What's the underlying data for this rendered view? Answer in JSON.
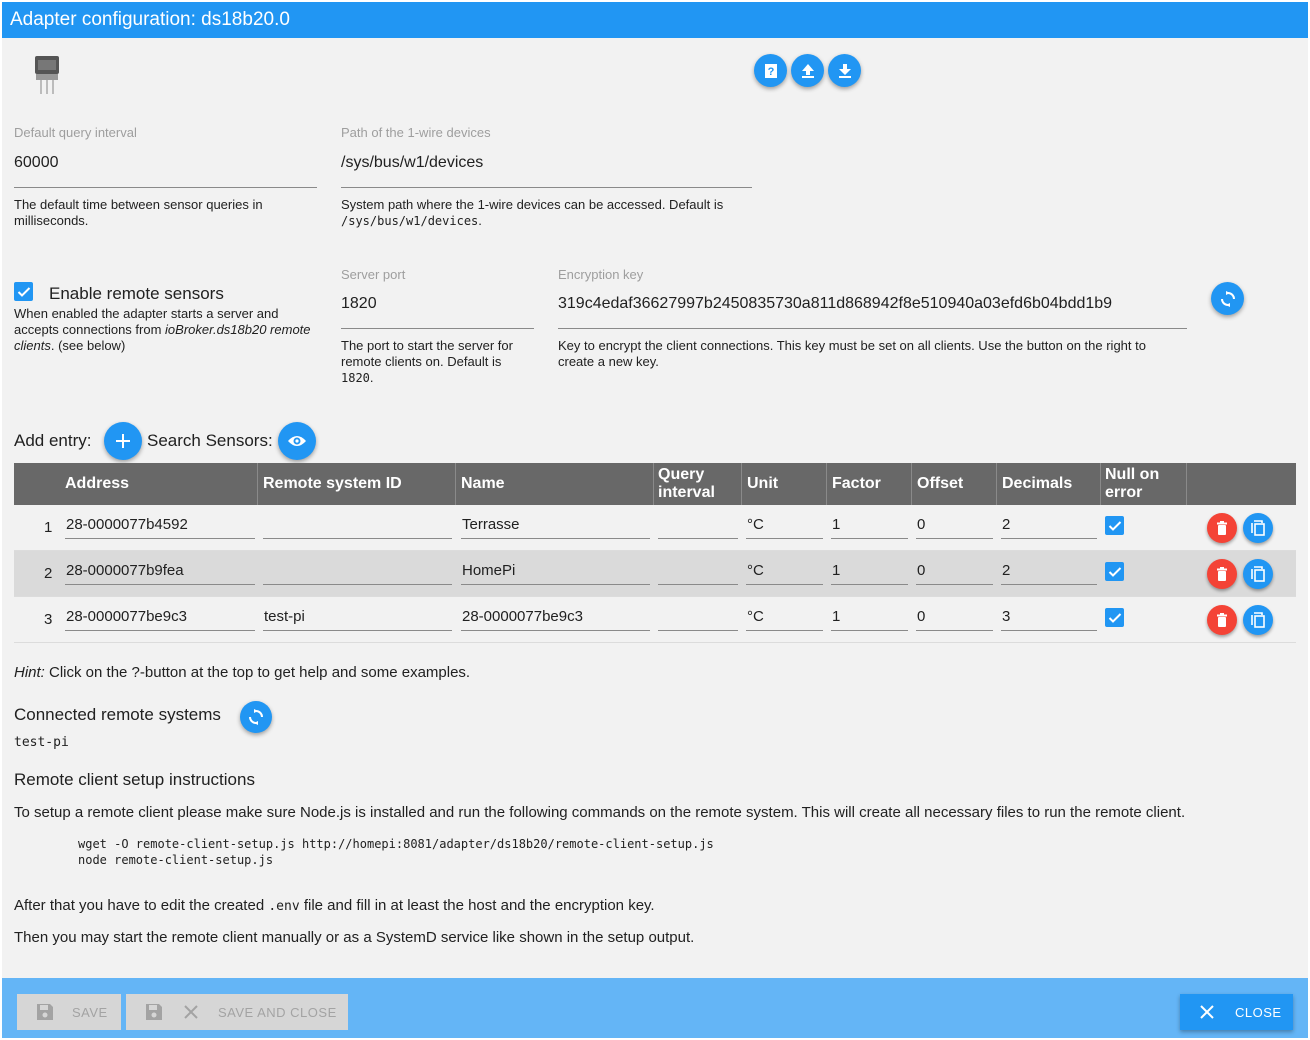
{
  "window": {
    "title": "Adapter configuration: ds18b20.0"
  },
  "toolbar": {
    "help_icon": "help-book-icon",
    "upload_icon": "upload-icon",
    "download_icon": "download-icon"
  },
  "settings": {
    "query_interval": {
      "label": "Default query interval",
      "value": "60000",
      "help": "The default time between sensor queries in milliseconds."
    },
    "w1_path": {
      "label": "Path of the 1-wire devices",
      "value": "/sys/bus/w1/devices",
      "help_prefix": "System path where the 1-wire devices can be accessed. Default is",
      "help_code": "/sys/bus/w1/devices",
      "help_suffix": "."
    },
    "remote": {
      "checkbox_label": "Enable remote sensors",
      "checked": true,
      "help_prefix": "When enabled the adapter starts a server and accepts connections from",
      "help_em": "ioBroker.ds18b20 remote clients",
      "help_suffix": ". (see below)"
    },
    "server_port": {
      "label": "Server port",
      "value": "1820",
      "help_prefix": "The port to start the server for remote clients on. Default is",
      "help_code": "1820",
      "help_suffix": "."
    },
    "encryption_key": {
      "label": "Encryption key",
      "value": "319c4edaf36627997b2450835730a811d868942f8e510940a03efd6b04bdd1b9",
      "help": "Key to encrypt the client connections. This key must be set on all clients. Use the button on the right to create a new key."
    }
  },
  "sensors": {
    "add_label": "Add entry:",
    "search_label": "Search Sensors:",
    "columns": {
      "address": "Address",
      "remote_id": "Remote system ID",
      "name": "Name",
      "query_interval": "Query interval",
      "unit": "Unit",
      "factor": "Factor",
      "offset": "Offset",
      "decimals": "Decimals",
      "null_on_error": "Null on error"
    },
    "rows": [
      {
        "num": "1",
        "address": "28-0000077b4592",
        "remote_id": "",
        "name": "Terrasse",
        "query_interval": "",
        "unit": "°C",
        "factor": "1",
        "offset": "0",
        "decimals": "2",
        "null_on_error": true
      },
      {
        "num": "2",
        "address": "28-0000077b9fea",
        "remote_id": "",
        "name": "HomePi",
        "query_interval": "",
        "unit": "°C",
        "factor": "1",
        "offset": "0",
        "decimals": "2",
        "null_on_error": true
      },
      {
        "num": "3",
        "address": "28-0000077be9c3",
        "remote_id": "test-pi",
        "name": "28-0000077be9c3",
        "query_interval": "",
        "unit": "°C",
        "factor": "1",
        "offset": "0",
        "decimals": "3",
        "null_on_error": true
      }
    ]
  },
  "hint": {
    "em": "Hint:",
    "text": " Click on the ?-button at the top to get help and some examples."
  },
  "remote_systems": {
    "heading": "Connected remote systems",
    "items": [
      "test-pi"
    ]
  },
  "instructions": {
    "heading": "Remote client setup instructions",
    "intro": "To setup a remote client please make sure Node.js is installed and run the following commands on the remote system. This will create all necessary files to run the remote client.",
    "code_line1": "wget -O remote-client-setup.js http://homepi:8081/adapter/ds18b20/remote-client-setup.js",
    "code_line2": "node remote-client-setup.js",
    "after_prefix": "After that you have to edit the created",
    "after_code": ".env",
    "after_suffix": "file and fill in at least the host and the encryption key.",
    "then": "Then you may start the remote client manually or as a SystemD service like shown in the setup output."
  },
  "footer": {
    "save": "SAVE",
    "save_close": "SAVE AND CLOSE",
    "close": "CLOSE"
  },
  "colors": {
    "primary": "#2196f3",
    "danger": "#f44336",
    "title_bar": "#2196f3",
    "footer": "#64b5f6"
  }
}
